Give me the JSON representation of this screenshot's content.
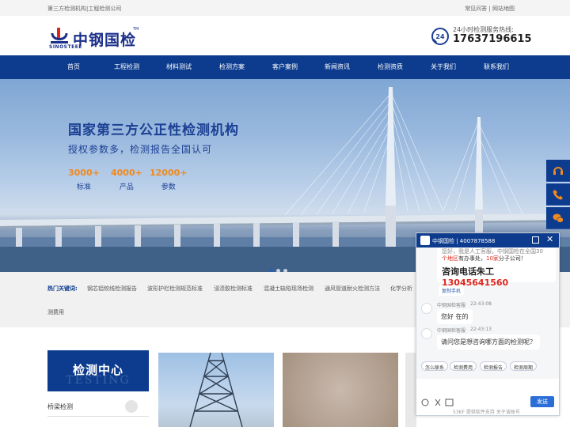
{
  "topbar": {
    "left_text": "第三方检测机构|工程检测公司",
    "right_text": "常见问答 | 网站地图"
  },
  "header": {
    "logo_cn": "中钢国检",
    "logo_en": "SINOSTEEL",
    "logo_tm": "TM",
    "hotline_label": "24小时检测服务热线:",
    "hotline_number": "17637196615",
    "hotline_icon_text": "24"
  },
  "nav": {
    "items": [
      "首页",
      "工程检测",
      "材料测试",
      "检测方案",
      "客户案例",
      "新闻资讯",
      "检测资质",
      "关于我们",
      "联系我们"
    ]
  },
  "banner": {
    "title": "国家第三方公正性检测机构",
    "subtitle": "授权参数多，检测报告全国认可",
    "stats": [
      {
        "value": "3000+",
        "label": "标准"
      },
      {
        "value": "4000+",
        "label": "产品"
      },
      {
        "value": "12000+",
        "label": "参数"
      }
    ]
  },
  "hot": {
    "label": "热门关键词:",
    "keywords": [
      "钢芯铝绞线检测报告",
      "波形护栏检测规范标准",
      "浸渍胶检测标准",
      "混凝土缺陷现场检测",
      "通风管道耐火检测方法",
      "化学分析"
    ],
    "keyword_second_line": "测费用"
  },
  "testing": {
    "title_cn": "检测中心",
    "title_en": "TESTING",
    "first_item": "桥梁检测"
  },
  "chat": {
    "header_text": "中钢国检 | 4007878588",
    "first_line": "您好，我是人工客服，中钢国检在全国30",
    "second_line_red_a": "个地区",
    "second_line_mid": "有办事处，",
    "second_line_red_b": "10家",
    "second_line_end": "分子公司！",
    "consult_label": "咨询电话朱工",
    "consult_number": "13045641560",
    "copy_tag": "复制手机",
    "agent_name_1": "中钢国检客服",
    "time_1": "22:43:08",
    "message_1": "您好 在的",
    "agent_name_2": "中钢国检客服",
    "time_2": "22:43:13",
    "message_2": "请问您是想咨询哪方面的检测呢？",
    "quick_replies": [
      "怎么联系",
      "检测费用",
      "检测报告",
      "检测周期"
    ],
    "send_label": "发送",
    "powered_by": "53KF 提供软件支持 关于该账号"
  },
  "colors": {
    "brand_blue": "#0d3c8e",
    "accent_orange": "#f08a1d",
    "alert_red": "#e0261b"
  }
}
